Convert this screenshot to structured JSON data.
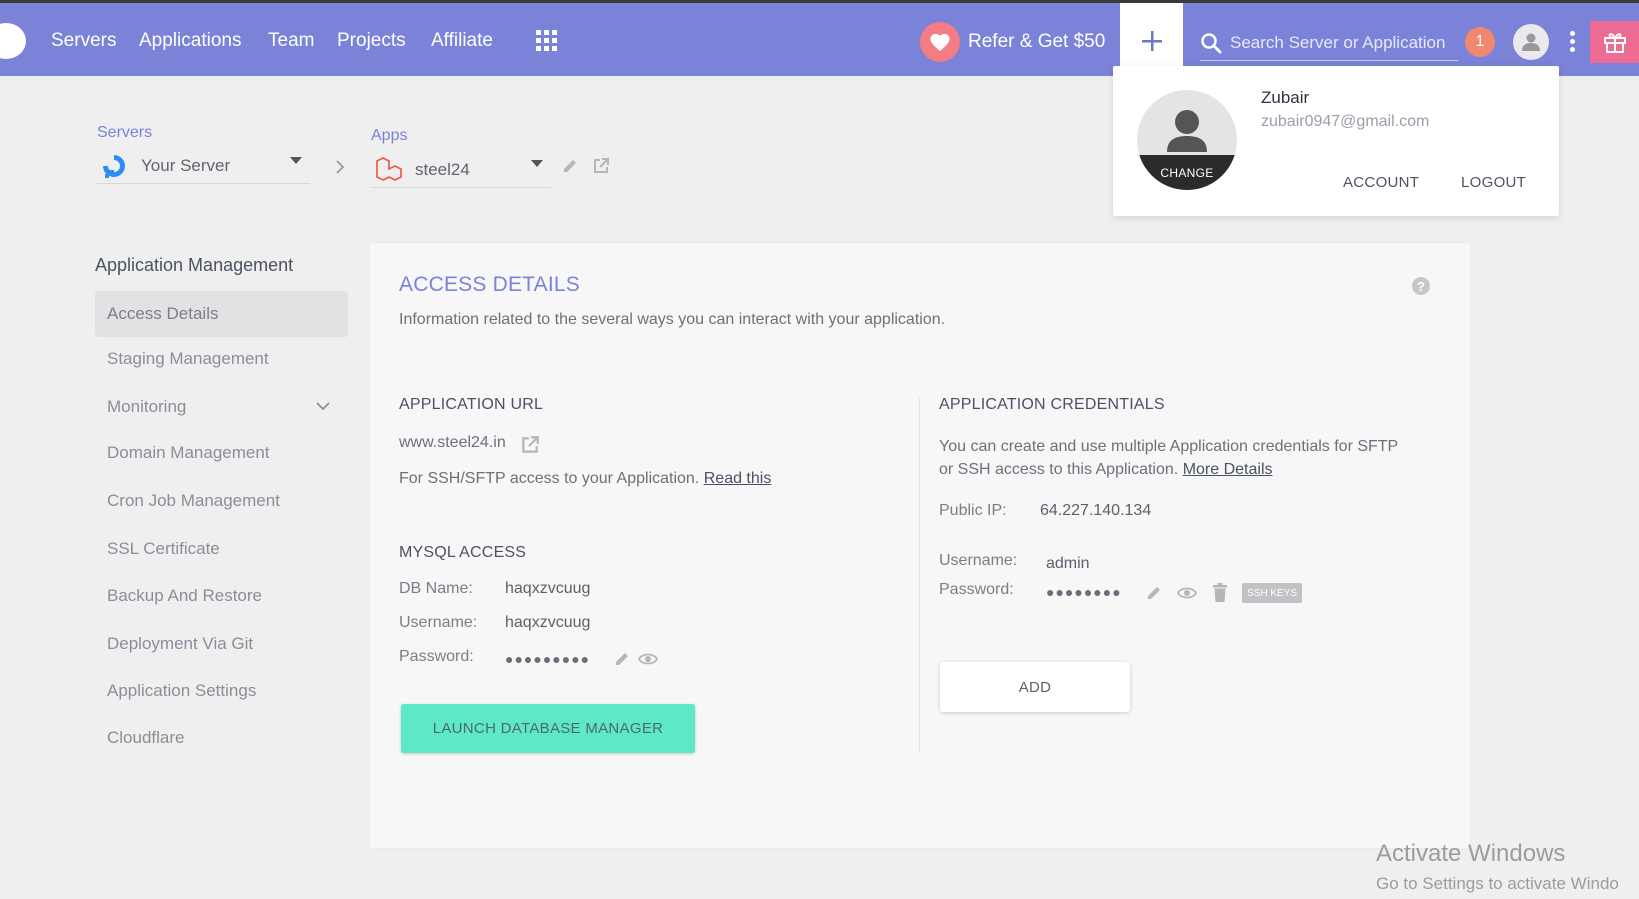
{
  "nav": {
    "items": [
      "Servers",
      "Applications",
      "Team",
      "Projects",
      "Affiliate"
    ],
    "refer_label": "Refer & Get $50",
    "search_placeholder": "Search Server or Application",
    "notification_count": "1"
  },
  "breadcrumb": {
    "servers_label": "Servers",
    "server_value": "Your Server",
    "apps_label": "Apps",
    "app_value": "steel24"
  },
  "sidebar": {
    "title": "Application Management",
    "items": [
      {
        "label": "Access Details",
        "active": true
      },
      {
        "label": "Staging Management"
      },
      {
        "label": "Monitoring",
        "expandable": true
      },
      {
        "label": "Domain Management"
      },
      {
        "label": "Cron Job Management"
      },
      {
        "label": "SSL Certificate"
      },
      {
        "label": "Backup And Restore"
      },
      {
        "label": "Deployment Via Git"
      },
      {
        "label": "Application Settings"
      },
      {
        "label": "Cloudflare"
      }
    ]
  },
  "access": {
    "title": "ACCESS DETAILS",
    "subtitle": "Information related to the several ways you can interact with your application.",
    "app_url": {
      "heading": "APPLICATION URL",
      "url": "www.steel24.in",
      "ssh_text": "For SSH/SFTP access to your Application.",
      "read_this": "Read this"
    },
    "mysql": {
      "heading": "MYSQL ACCESS",
      "db_name_label": "DB Name:",
      "db_name": "haqxzvcuug",
      "username_label": "Username:",
      "username": "haqxzvcuug",
      "password_label": "Password:",
      "password_mask": "●●●●●●●●●",
      "launch_label": "LAUNCH DATABASE MANAGER"
    },
    "credentials": {
      "heading": "APPLICATION CREDENTIALS",
      "desc_line1": "You can create and use multiple Application credentials for SFTP",
      "desc_line2": "or SSH access to this Application.",
      "more_details": "More Details",
      "public_ip_label": "Public IP:",
      "public_ip": "64.227.140.134",
      "username_label": "Username:",
      "username": "admin",
      "password_label": "Password:",
      "password_mask": "●●●●●●●●",
      "ssh_keys": "SSH KEYS",
      "add_label": "ADD"
    }
  },
  "profile": {
    "name": "Zubair",
    "email": "zubair0947@gmail.com",
    "change": "CHANGE",
    "account": "ACCOUNT",
    "logout": "LOGOUT"
  },
  "watermark": {
    "line1": "Activate Windows",
    "line2": "Go to Settings to activate Windo"
  },
  "colors": {
    "topbar": "#7b83d8",
    "accent": "#7b83d8",
    "launch_button": "#5de8c7",
    "notification": "#f0876e",
    "gift": "#ee6b93"
  }
}
